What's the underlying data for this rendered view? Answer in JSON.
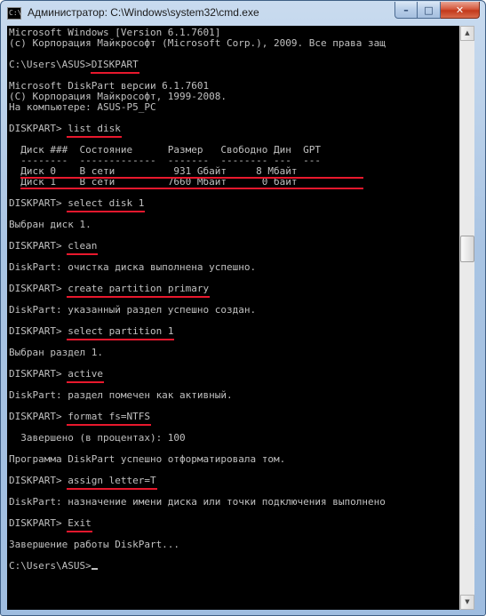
{
  "window": {
    "title": "Администратор: C:\\Windows\\system32\\cmd.exe",
    "icon_text": "C:\\",
    "buttons": {
      "minimize": "–",
      "maximize": "□",
      "close": "✕"
    }
  },
  "console": {
    "lines": [
      "Microsoft Windows [Version 6.1.7601]",
      "(c) Корпорация Майкрософт (Microsoft Corp.), 2009. Все права защ",
      "",
      "C:\\Users\\ASUS>DISKPART",
      "",
      "Microsoft DiskPart версии 6.1.7601",
      "(C) Корпорация Майкрософт, 1999-2008.",
      "На компьютере: ASUS-P5_PC",
      "",
      "DISKPART> list disk",
      "",
      "  Диск ###  Состояние      Размер   Свободно Дин  GPT",
      "  --------  -------------  -------  -------- ---  ---",
      "  Диск 0    В сети          931 Gбайт     8 Мбайт",
      "  Диск 1    В сети         7660 Мбайт      0 байт",
      "",
      "DISKPART> select disk 1",
      "",
      "Выбран диск 1.",
      "",
      "DISKPART> clean",
      "",
      "DiskPart: очистка диска выполнена успешно.",
      "",
      "DISKPART> create partition primary",
      "",
      "DiskPart: указанный раздел успешно создан.",
      "",
      "DISKPART> select partition 1",
      "",
      "Выбран раздел 1.",
      "",
      "DISKPART> active",
      "",
      "DiskPart: раздел помечен как активный.",
      "",
      "DISKPART> format fs=NTFS",
      "",
      "  Завершено (в процентах): 100",
      "",
      "Программа DiskPart успешно отформатировала том.",
      "",
      "DISKPART> assign letter=T",
      "",
      "DiskPart: назначение имени диска или точки подключения выполнено",
      "",
      "DISKPART> Exit",
      "",
      "Завершение работы DiskPart...",
      "",
      "C:\\Users\\ASUS>"
    ],
    "highlighted_commands": [
      {
        "line": 3,
        "prefix": "C:\\Users\\ASUS>",
        "command": "DISKPART"
      },
      {
        "line": 9,
        "prefix": "DISKPART> ",
        "command": "list disk"
      },
      {
        "line": 16,
        "prefix": "DISKPART> ",
        "command": "select disk 1"
      },
      {
        "line": 20,
        "prefix": "DISKPART> ",
        "command": "clean"
      },
      {
        "line": 24,
        "prefix": "DISKPART> ",
        "command": "create partition primary"
      },
      {
        "line": 28,
        "prefix": "DISKPART> ",
        "command": "select partition 1"
      },
      {
        "line": 32,
        "prefix": "DISKPART> ",
        "command": "active"
      },
      {
        "line": 36,
        "prefix": "DISKPART> ",
        "command": "format fs=NTFS"
      },
      {
        "line": 42,
        "prefix": "DISKPART> ",
        "command": "assign letter=T"
      },
      {
        "line": 46,
        "prefix": "DISKPART> ",
        "command": "Exit"
      }
    ],
    "highlighted_rows": [
      13,
      14
    ],
    "cursor_line": 50
  },
  "colors": {
    "console_bg": "#000000",
    "console_text": "#c0c0c0",
    "annotation": "#e8182d"
  }
}
